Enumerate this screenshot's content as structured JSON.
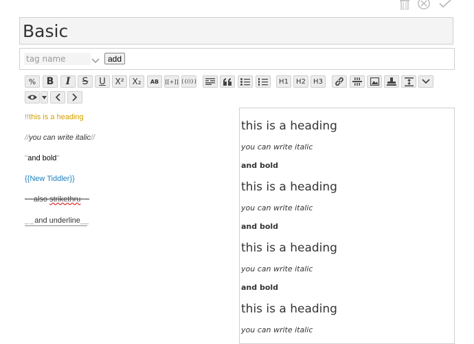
{
  "header": {
    "actions": [
      {
        "name": "delete-icon"
      },
      {
        "name": "cancel-icon"
      },
      {
        "name": "confirm-icon"
      }
    ]
  },
  "title": {
    "value": "Basic"
  },
  "tags": {
    "placeholder": "tag name",
    "add_label": "add"
  },
  "toolbar": {
    "row1": [
      {
        "name": "excise-button",
        "glyph": "%"
      },
      {
        "name": "bold-button",
        "glyph": "B"
      },
      {
        "name": "italic-button",
        "glyph": "I"
      },
      {
        "name": "strikethrough-button",
        "glyph": "S"
      },
      {
        "name": "underline-button",
        "glyph": "U"
      },
      {
        "name": "superscript-button",
        "glyph": "X²"
      },
      {
        "name": "subscript-button",
        "glyph": "X₂"
      },
      {
        "name": "smallcaps-button",
        "glyph": "AB"
      },
      {
        "name": "transclude-button",
        "glyph": "[[+]]"
      },
      {
        "name": "macro-button",
        "glyph": "{{()}}"
      },
      {
        "name": "mono-block-button",
        "glyph": ""
      },
      {
        "name": "quote-button",
        "glyph": ""
      },
      {
        "name": "bullet-list-button",
        "glyph": ""
      },
      {
        "name": "numbered-list-button",
        "glyph": ""
      },
      {
        "name": "heading-1-button",
        "glyph": "H1"
      },
      {
        "name": "heading-2-button",
        "glyph": "H2"
      },
      {
        "name": "heading-3-button",
        "glyph": "H3"
      },
      {
        "name": "link-button",
        "glyph": ""
      },
      {
        "name": "rule-button",
        "glyph": ""
      },
      {
        "name": "image-button",
        "glyph": ""
      },
      {
        "name": "stamp-button",
        "glyph": ""
      },
      {
        "name": "size-button",
        "glyph": ""
      },
      {
        "name": "more-button",
        "glyph": ""
      }
    ]
  },
  "editor": {
    "l1_markup": "!!",
    "l1_text": "this is a heading",
    "l2_open": "//",
    "l2_text": "you can write italic",
    "l2_close": "//",
    "l3_open": "''",
    "l3_text": "and bold",
    "l3_close": "''",
    "l4_text": "{{New Tiddler}}",
    "l5_open": "~~",
    "l5_text_a": "also ",
    "l5_text_b": "strikethru",
    "l5_close": "~~",
    "l6_open": "__",
    "l6_text": "and underline",
    "l6_close": "__"
  },
  "preview": {
    "heading": "this is a heading",
    "italic": "you can write italic",
    "bold": "and bold"
  }
}
